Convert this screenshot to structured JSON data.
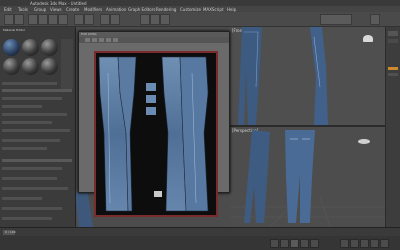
{
  "app": {
    "title": "Autodesk 3ds Max - Untitled",
    "menu": [
      "Edit",
      "Tools",
      "Group",
      "Views",
      "Create",
      "Modifiers",
      "Animation",
      "Graph Editors",
      "Rendering",
      "Customize",
      "MAXScript",
      "Help"
    ]
  },
  "viewports": {
    "top_right": {
      "label": "[Front]"
    },
    "bottom_right": {
      "label": "[Perspective]"
    }
  },
  "uv_editor": {
    "title": "Edit UVWs"
  },
  "material_editor": {
    "title": "Material Editor"
  },
  "timeline": {
    "frame": "0 / 100"
  },
  "colors": {
    "accent_red": "#7a2b2b",
    "denim": "#3f5f86"
  },
  "icons": [
    "undo-icon",
    "redo-icon",
    "select-icon",
    "move-icon",
    "rotate-icon",
    "scale-icon",
    "play-icon",
    "stop-icon",
    "zoom-icon",
    "pan-icon",
    "orbit-icon",
    "maximize-icon"
  ]
}
